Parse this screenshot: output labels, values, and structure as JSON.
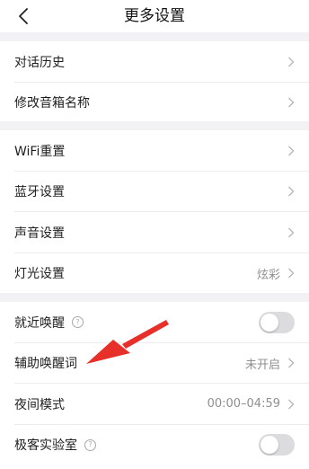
{
  "header": {
    "title": "更多设置",
    "back_icon": "chevron-left-icon"
  },
  "groups": [
    {
      "items": [
        {
          "label": "对话历史"
        },
        {
          "label": "修改音箱名称"
        }
      ]
    },
    {
      "items": [
        {
          "label": "WiFi重置"
        },
        {
          "label": "蓝牙设置"
        },
        {
          "label": "声音设置"
        },
        {
          "label": "灯光设置",
          "value": "炫彩"
        }
      ]
    },
    {
      "items": [
        {
          "label": "就近唤醒",
          "help": "?",
          "toggle": false
        },
        {
          "label": "辅助唤醒词",
          "value": "未开启"
        },
        {
          "label": "夜间模式",
          "value": "00:00–04:59"
        },
        {
          "label": "极客实验室",
          "help": "?",
          "toggle": false
        }
      ]
    }
  ],
  "annotation": {
    "type": "red-arrow",
    "color": "#e8302a",
    "points_to": "辅助唤醒词"
  },
  "colors": {
    "background": "#f2f2f4",
    "card": "#ffffff",
    "value_text": "#8f8f8f",
    "toggle_off": "#dcdcdf"
  }
}
